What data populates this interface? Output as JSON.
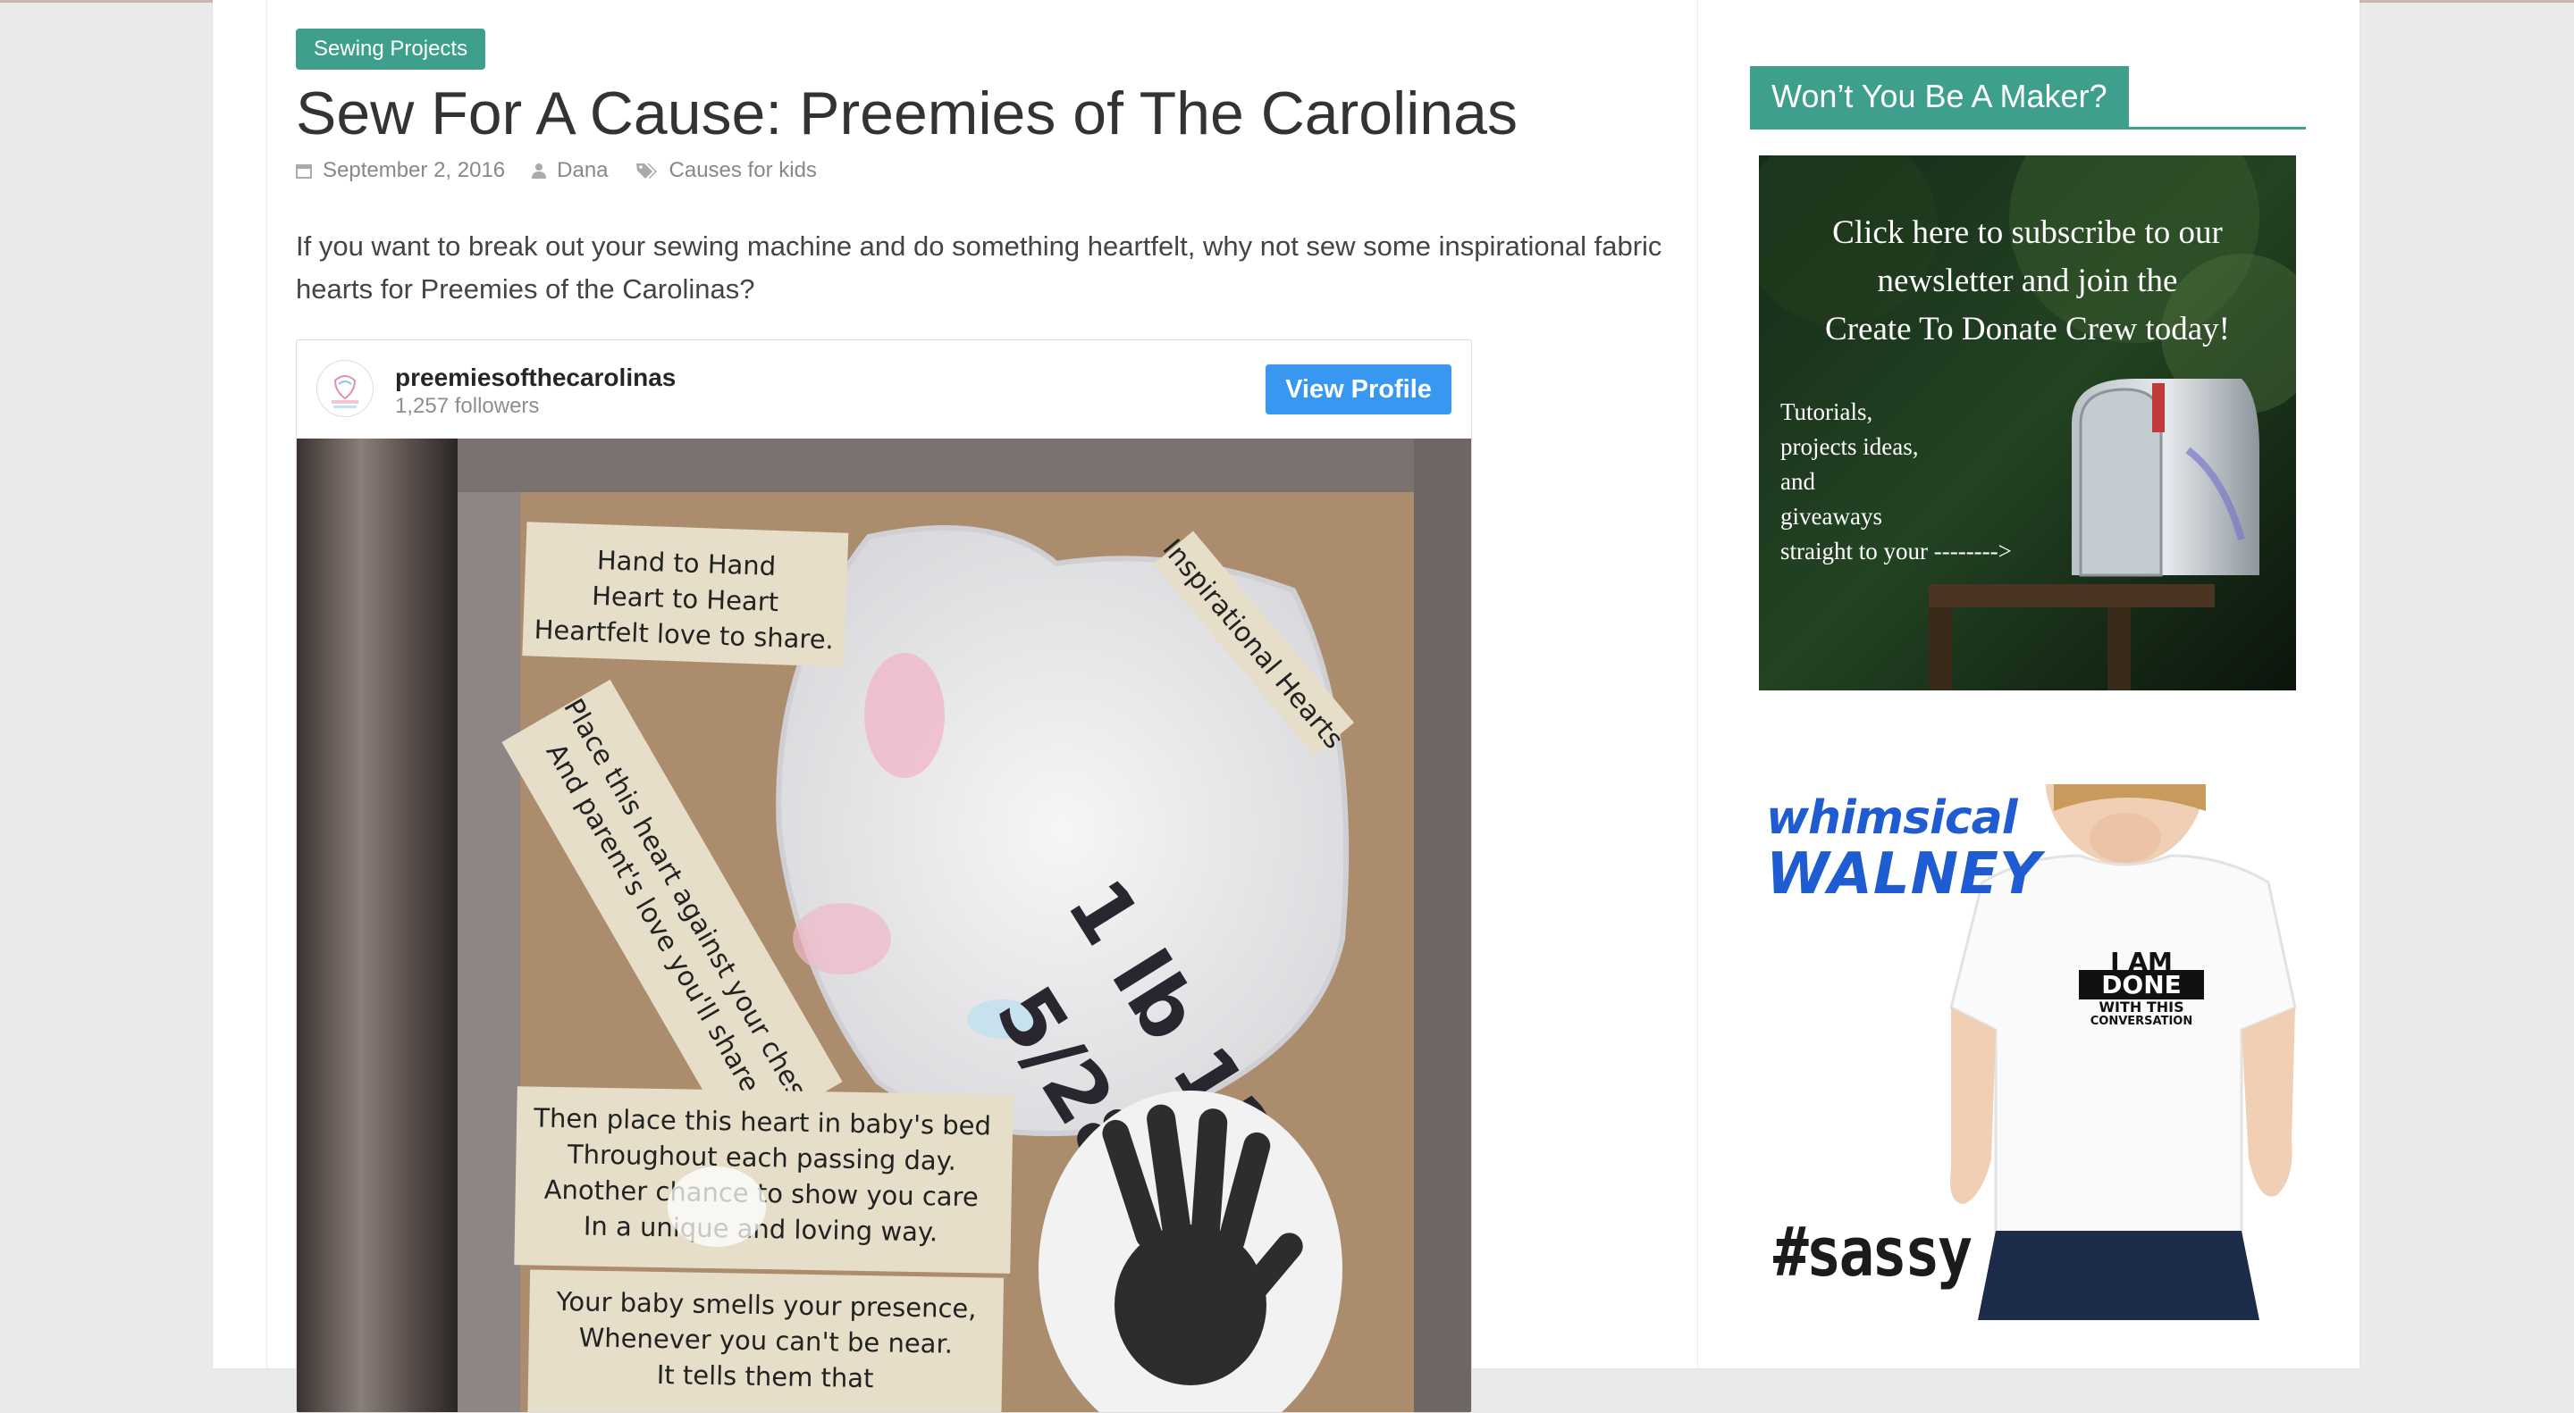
{
  "article": {
    "category": "Sewing Projects",
    "title": "Sew For A Cause: Preemies of The Carolinas",
    "date": "September 2, 2016",
    "author": "Dana",
    "tag": "Causes for kids",
    "excerpt": "If you want to break out your sewing machine and do something heartfelt, why not sew some inspirational fabric hearts for Preemies of the Carolinas?"
  },
  "instagram": {
    "username": "preemiesofthecarolinas",
    "followers": "1,257 followers",
    "button": "View Profile",
    "photo_text": {
      "card1": [
        "Hand to Hand",
        "Heart to Heart",
        "Heartfelt love to share."
      ],
      "card2": [
        "Place this heart against your chest",
        "And parent's love you'll share."
      ],
      "card3": "Inspirational Hearts",
      "card4": [
        "Then place this heart in baby's bed",
        "Throughout each passing day.",
        "Another chance to show you care",
        "In a unique and loving way."
      ],
      "card5": [
        "Your baby smells your presence,",
        "Whenever you can't be near.",
        "It tells them that"
      ],
      "heart_lines": [
        "1 lb  11oz",
        "5/28/16"
      ]
    }
  },
  "sidebar": {
    "widget_title": "Won’t You Be A Maker?",
    "newsletter": {
      "headline_lines": [
        "Click here to subscribe to our",
        "newsletter and join the",
        "Create To Donate Crew today!"
      ],
      "sub_lines": [
        "Tutorials,",
        "projects ideas,",
        "and",
        "giveaways",
        "straight to your -------->"
      ]
    },
    "ad": {
      "brand_line1": "whimsical",
      "brand_line2": "WALNEY",
      "shirt_lines": [
        "I AM",
        "DONE",
        "WITH THIS",
        "CONVERSATION"
      ],
      "hashtag": "#sassy"
    }
  },
  "colors": {
    "accent": "#3d9f8c",
    "button_blue": "#3897f0",
    "title_text": "#333333"
  }
}
